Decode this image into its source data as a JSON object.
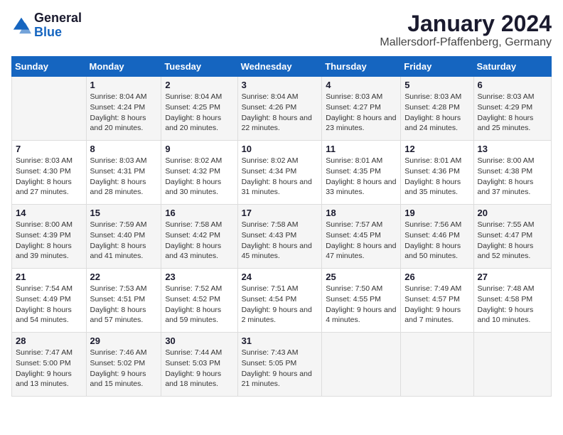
{
  "header": {
    "logo_general": "General",
    "logo_blue": "Blue",
    "month_year": "January 2024",
    "location": "Mallersdorf-Pfaffenberg, Germany"
  },
  "weekdays": [
    "Sunday",
    "Monday",
    "Tuesday",
    "Wednesday",
    "Thursday",
    "Friday",
    "Saturday"
  ],
  "weeks": [
    [
      {
        "day": "",
        "sunrise": "",
        "sunset": "",
        "daylight": ""
      },
      {
        "day": "1",
        "sunrise": "Sunrise: 8:04 AM",
        "sunset": "Sunset: 4:24 PM",
        "daylight": "Daylight: 8 hours and 20 minutes."
      },
      {
        "day": "2",
        "sunrise": "Sunrise: 8:04 AM",
        "sunset": "Sunset: 4:25 PM",
        "daylight": "Daylight: 8 hours and 20 minutes."
      },
      {
        "day": "3",
        "sunrise": "Sunrise: 8:04 AM",
        "sunset": "Sunset: 4:26 PM",
        "daylight": "Daylight: 8 hours and 22 minutes."
      },
      {
        "day": "4",
        "sunrise": "Sunrise: 8:03 AM",
        "sunset": "Sunset: 4:27 PM",
        "daylight": "Daylight: 8 hours and 23 minutes."
      },
      {
        "day": "5",
        "sunrise": "Sunrise: 8:03 AM",
        "sunset": "Sunset: 4:28 PM",
        "daylight": "Daylight: 8 hours and 24 minutes."
      },
      {
        "day": "6",
        "sunrise": "Sunrise: 8:03 AM",
        "sunset": "Sunset: 4:29 PM",
        "daylight": "Daylight: 8 hours and 25 minutes."
      }
    ],
    [
      {
        "day": "7",
        "sunrise": "Sunrise: 8:03 AM",
        "sunset": "Sunset: 4:30 PM",
        "daylight": "Daylight: 8 hours and 27 minutes."
      },
      {
        "day": "8",
        "sunrise": "Sunrise: 8:03 AM",
        "sunset": "Sunset: 4:31 PM",
        "daylight": "Daylight: 8 hours and 28 minutes."
      },
      {
        "day": "9",
        "sunrise": "Sunrise: 8:02 AM",
        "sunset": "Sunset: 4:32 PM",
        "daylight": "Daylight: 8 hours and 30 minutes."
      },
      {
        "day": "10",
        "sunrise": "Sunrise: 8:02 AM",
        "sunset": "Sunset: 4:34 PM",
        "daylight": "Daylight: 8 hours and 31 minutes."
      },
      {
        "day": "11",
        "sunrise": "Sunrise: 8:01 AM",
        "sunset": "Sunset: 4:35 PM",
        "daylight": "Daylight: 8 hours and 33 minutes."
      },
      {
        "day": "12",
        "sunrise": "Sunrise: 8:01 AM",
        "sunset": "Sunset: 4:36 PM",
        "daylight": "Daylight: 8 hours and 35 minutes."
      },
      {
        "day": "13",
        "sunrise": "Sunrise: 8:00 AM",
        "sunset": "Sunset: 4:38 PM",
        "daylight": "Daylight: 8 hours and 37 minutes."
      }
    ],
    [
      {
        "day": "14",
        "sunrise": "Sunrise: 8:00 AM",
        "sunset": "Sunset: 4:39 PM",
        "daylight": "Daylight: 8 hours and 39 minutes."
      },
      {
        "day": "15",
        "sunrise": "Sunrise: 7:59 AM",
        "sunset": "Sunset: 4:40 PM",
        "daylight": "Daylight: 8 hours and 41 minutes."
      },
      {
        "day": "16",
        "sunrise": "Sunrise: 7:58 AM",
        "sunset": "Sunset: 4:42 PM",
        "daylight": "Daylight: 8 hours and 43 minutes."
      },
      {
        "day": "17",
        "sunrise": "Sunrise: 7:58 AM",
        "sunset": "Sunset: 4:43 PM",
        "daylight": "Daylight: 8 hours and 45 minutes."
      },
      {
        "day": "18",
        "sunrise": "Sunrise: 7:57 AM",
        "sunset": "Sunset: 4:45 PM",
        "daylight": "Daylight: 8 hours and 47 minutes."
      },
      {
        "day": "19",
        "sunrise": "Sunrise: 7:56 AM",
        "sunset": "Sunset: 4:46 PM",
        "daylight": "Daylight: 8 hours and 50 minutes."
      },
      {
        "day": "20",
        "sunrise": "Sunrise: 7:55 AM",
        "sunset": "Sunset: 4:47 PM",
        "daylight": "Daylight: 8 hours and 52 minutes."
      }
    ],
    [
      {
        "day": "21",
        "sunrise": "Sunrise: 7:54 AM",
        "sunset": "Sunset: 4:49 PM",
        "daylight": "Daylight: 8 hours and 54 minutes."
      },
      {
        "day": "22",
        "sunrise": "Sunrise: 7:53 AM",
        "sunset": "Sunset: 4:51 PM",
        "daylight": "Daylight: 8 hours and 57 minutes."
      },
      {
        "day": "23",
        "sunrise": "Sunrise: 7:52 AM",
        "sunset": "Sunset: 4:52 PM",
        "daylight": "Daylight: 8 hours and 59 minutes."
      },
      {
        "day": "24",
        "sunrise": "Sunrise: 7:51 AM",
        "sunset": "Sunset: 4:54 PM",
        "daylight": "Daylight: 9 hours and 2 minutes."
      },
      {
        "day": "25",
        "sunrise": "Sunrise: 7:50 AM",
        "sunset": "Sunset: 4:55 PM",
        "daylight": "Daylight: 9 hours and 4 minutes."
      },
      {
        "day": "26",
        "sunrise": "Sunrise: 7:49 AM",
        "sunset": "Sunset: 4:57 PM",
        "daylight": "Daylight: 9 hours and 7 minutes."
      },
      {
        "day": "27",
        "sunrise": "Sunrise: 7:48 AM",
        "sunset": "Sunset: 4:58 PM",
        "daylight": "Daylight: 9 hours and 10 minutes."
      }
    ],
    [
      {
        "day": "28",
        "sunrise": "Sunrise: 7:47 AM",
        "sunset": "Sunset: 5:00 PM",
        "daylight": "Daylight: 9 hours and 13 minutes."
      },
      {
        "day": "29",
        "sunrise": "Sunrise: 7:46 AM",
        "sunset": "Sunset: 5:02 PM",
        "daylight": "Daylight: 9 hours and 15 minutes."
      },
      {
        "day": "30",
        "sunrise": "Sunrise: 7:44 AM",
        "sunset": "Sunset: 5:03 PM",
        "daylight": "Daylight: 9 hours and 18 minutes."
      },
      {
        "day": "31",
        "sunrise": "Sunrise: 7:43 AM",
        "sunset": "Sunset: 5:05 PM",
        "daylight": "Daylight: 9 hours and 21 minutes."
      },
      {
        "day": "",
        "sunrise": "",
        "sunset": "",
        "daylight": ""
      },
      {
        "day": "",
        "sunrise": "",
        "sunset": "",
        "daylight": ""
      },
      {
        "day": "",
        "sunrise": "",
        "sunset": "",
        "daylight": ""
      }
    ]
  ]
}
